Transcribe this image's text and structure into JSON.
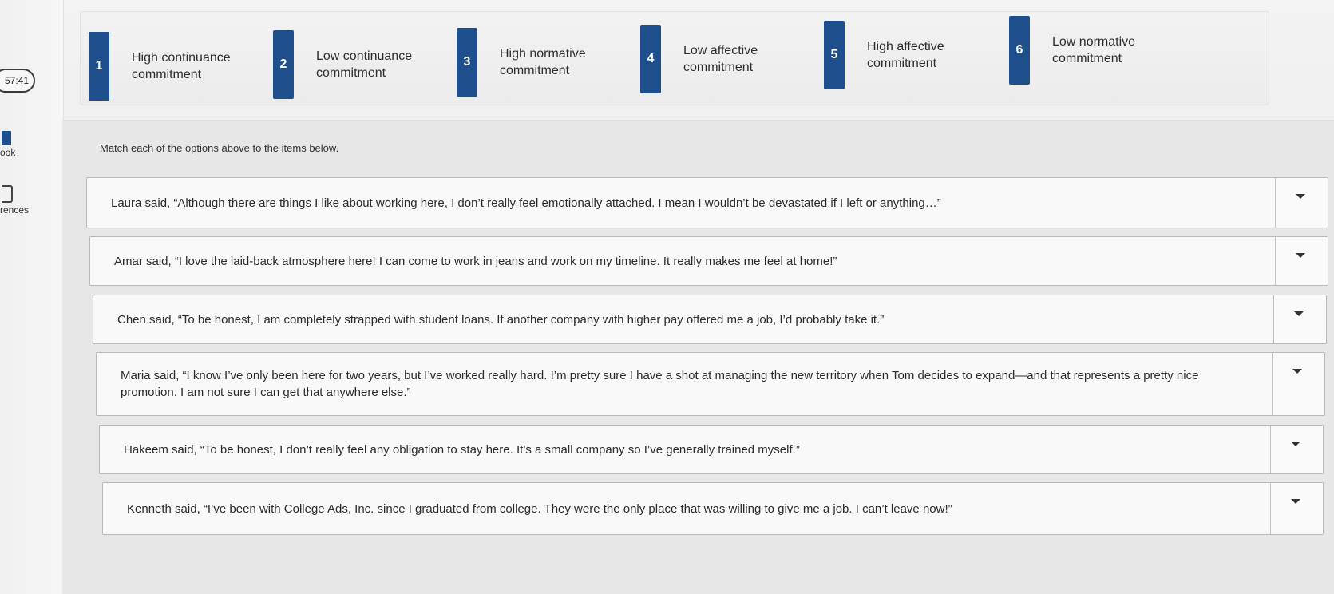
{
  "timer": "57:41",
  "rail": {
    "book_label": "ook",
    "references_label": "rences"
  },
  "options": [
    {
      "num": "1",
      "label": "High continuance commitment"
    },
    {
      "num": "2",
      "label": "Low continuance commitment"
    },
    {
      "num": "3",
      "label": "High normative commitment"
    },
    {
      "num": "4",
      "label": "Low affective commitment"
    },
    {
      "num": "5",
      "label": "High affective commitment"
    },
    {
      "num": "6",
      "label": "Low normative commitment"
    }
  ],
  "instruction": "Match each of the options above to the items below.",
  "items": [
    {
      "text": "Laura said, “Although there are things I like about working here, I don’t really feel emotionally attached. I mean I wouldn’t be devastated if I left or anything…”",
      "selected": ""
    },
    {
      "text": "Amar said, “I love the laid-back atmosphere here! I can come to work in jeans and work on my timeline. It really makes me feel at home!”",
      "selected": ""
    },
    {
      "text": "Chen said, “To be honest, I am completely strapped with student loans. If another company with higher pay offered me a job, I’d probably take it.”",
      "selected": ""
    },
    {
      "text": "Maria said, “I know I’ve only been here for two years, but I’ve worked really hard. I’m pretty sure I have a shot at managing the new territory when Tom decides to expand—and that represents a pretty nice promotion. I am not sure I can get that anywhere else.”",
      "selected": ""
    },
    {
      "text": "Hakeem said, “To be honest, I don’t really feel any obligation to stay here. It’s a small company so I’ve generally trained myself.”",
      "selected": ""
    },
    {
      "text": "Kenneth said, “I’ve been with College Ads, Inc. since I graduated from college. They were the only place that was willing to give me a job. I can’t leave now!”",
      "selected": ""
    }
  ],
  "colors": {
    "accent": "#1f4e8c",
    "row_bg": "#f9f9f9",
    "panel_bg": "#e7e7e7"
  }
}
